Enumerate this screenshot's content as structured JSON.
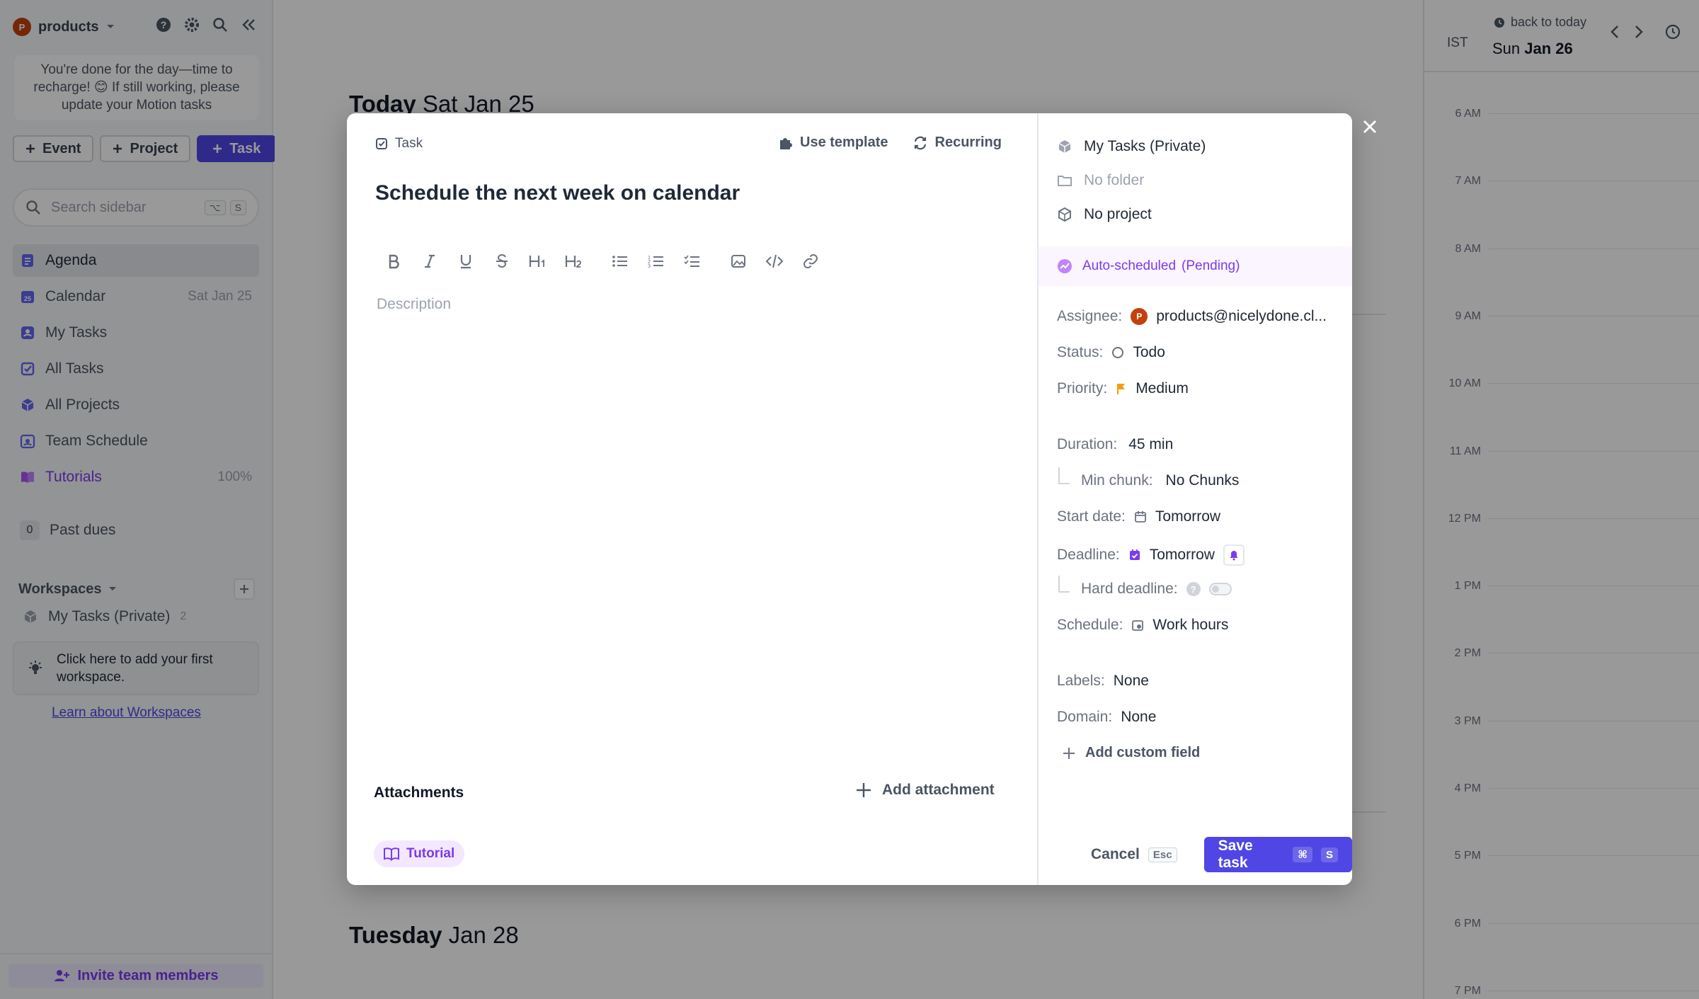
{
  "sidebar": {
    "workspace_name": "products",
    "avatar_letter": "P",
    "done_message": "You're done for the day—time to recharge! 😊 If still working, please update your Motion tasks",
    "quick_buttons": {
      "event": "Event",
      "project": "Project",
      "task": "Task"
    },
    "search": {
      "placeholder": "Search sidebar",
      "kbd1": "⌥",
      "kbd2": "S"
    },
    "nav": [
      {
        "label": "Agenda",
        "right": ""
      },
      {
        "label": "Calendar",
        "right": "Sat Jan 25"
      },
      {
        "label": "My Tasks",
        "right": ""
      },
      {
        "label": "All Tasks",
        "right": ""
      },
      {
        "label": "All Projects",
        "right": ""
      },
      {
        "label": "Team Schedule",
        "right": ""
      },
      {
        "label": "Tutorials",
        "right": "100%"
      }
    ],
    "past_dues": {
      "count": "0",
      "label": "Past dues"
    },
    "workspaces_label": "Workspaces",
    "workspace_item": {
      "label": "My Tasks (Private)",
      "count": "2"
    },
    "hint": "Click here to add your first workspace.",
    "learn_link": "Learn about Workspaces",
    "invite": "Invite team members"
  },
  "agenda": {
    "today_prefix": "Today",
    "today_date": "Sat Jan 25",
    "tuesday_prefix": "Tuesday",
    "tuesday_date": "Jan 28"
  },
  "calendar": {
    "tz": "IST",
    "back_to_today": "back to today",
    "day_name": "Sun",
    "day_date": "Jan 26",
    "hours": [
      "6 AM",
      "7 AM",
      "8 AM",
      "9 AM",
      "10 AM",
      "11 AM",
      "12 PM",
      "1 PM",
      "2 PM",
      "3 PM",
      "4 PM",
      "5 PM",
      "6 PM",
      "7 PM"
    ]
  },
  "modal": {
    "type_label": "Task",
    "use_template": "Use template",
    "recurring": "Recurring",
    "title": "Schedule the next week on calendar",
    "description_placeholder": "Description",
    "attachments": "Attachments",
    "add_attachment": "Add attachment",
    "tag": "Tutorial",
    "workspace": "My Tasks (Private)",
    "folder": "No folder",
    "project": "No project",
    "auto_scheduled": "Auto-scheduled",
    "auto_status": "(Pending)",
    "props": {
      "assignee_k": "Assignee:",
      "assignee_v": "products@nicelydone.cl...",
      "status_k": "Status:",
      "status_v": "Todo",
      "priority_k": "Priority:",
      "priority_v": "Medium",
      "duration_k": "Duration:",
      "duration_v": "45 min",
      "min_chunk_k": "Min chunk:",
      "min_chunk_v": "No Chunks",
      "start_k": "Start date:",
      "start_v": "Tomorrow",
      "deadline_k": "Deadline:",
      "deadline_v": "Tomorrow",
      "hard_deadline_k": "Hard deadline:",
      "schedule_k": "Schedule:",
      "schedule_v": "Work hours",
      "labels_k": "Labels:",
      "labels_v": "None",
      "domain_k": "Domain:",
      "domain_v": "None"
    },
    "add_custom_field": "Add custom field",
    "cancel": "Cancel",
    "cancel_kbd": "Esc",
    "save": "Save task",
    "save_kbd1": "⌘",
    "save_kbd2": "S"
  },
  "colors": {
    "accent": "#4f46e5",
    "purple": "#7c3aed",
    "avatar": "#c2410c",
    "priority_flag": "#f59e0b"
  }
}
